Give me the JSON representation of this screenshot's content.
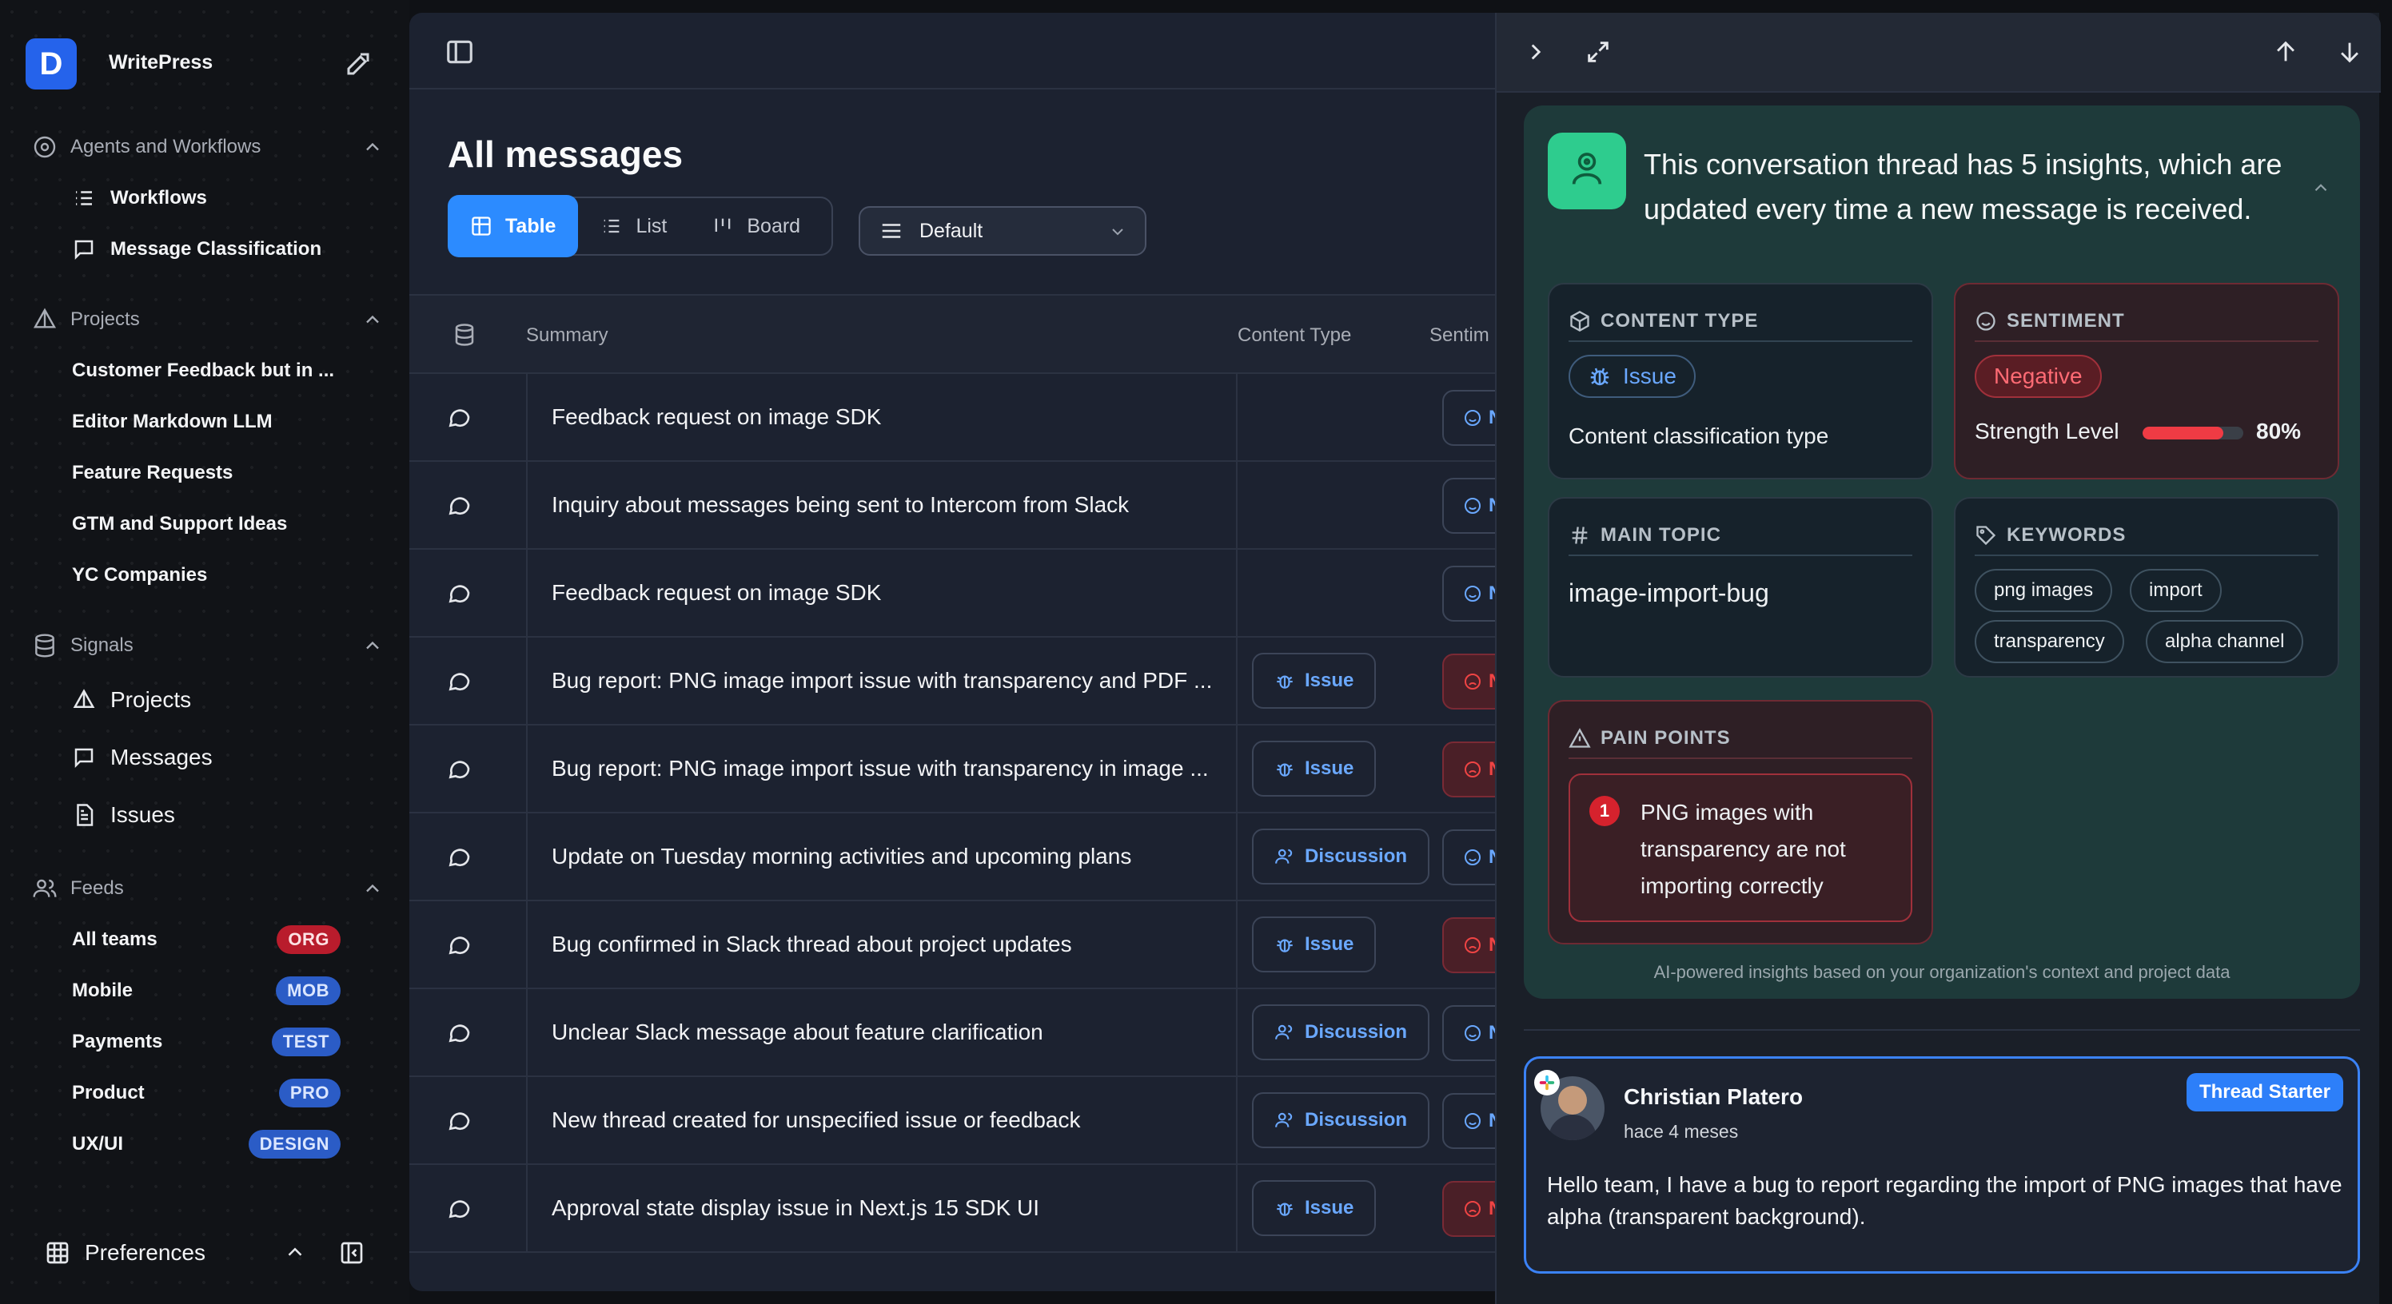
{
  "app": {
    "name": "WritePress",
    "logo_letter": "D"
  },
  "sidebar": {
    "sections": [
      {
        "label": "Agents and Workflows",
        "items": [
          "Workflows",
          "Message Classification"
        ]
      },
      {
        "label": "Projects",
        "items": [
          "Customer Feedback but in ...",
          "Editor Markdown LLM",
          "Feature Requests",
          "GTM and Support Ideas",
          "YC Companies"
        ]
      },
      {
        "label": "Signals",
        "items": [
          "Projects",
          "Messages",
          "Issues"
        ]
      },
      {
        "label": "Feeds",
        "items": [
          {
            "label": "All teams",
            "badge": "ORG"
          },
          {
            "label": "Mobile",
            "badge": "MOB"
          },
          {
            "label": "Payments",
            "badge": "TEST"
          },
          {
            "label": "Product",
            "badge": "PRO"
          },
          {
            "label": "UX/UI",
            "badge": "DESIGN"
          }
        ]
      }
    ],
    "preferences": "Preferences"
  },
  "main": {
    "title": "All messages",
    "views": [
      "Table",
      "List",
      "Board"
    ],
    "sort": "Default",
    "columns": [
      "Summary",
      "Content Type",
      "Sentim"
    ],
    "rows": [
      {
        "summary": "Feedback request on image SDK",
        "type": "",
        "sentiment": "N"
      },
      {
        "summary": "Inquiry about messages being sent to Intercom from Slack",
        "type": "",
        "sentiment": "N"
      },
      {
        "summary": "Feedback request on image SDK",
        "type": "",
        "sentiment": "N"
      },
      {
        "summary": "Bug report: PNG image import issue with transparency and PDF ...",
        "type": "Issue",
        "sentiment": "N"
      },
      {
        "summary": "Bug report: PNG image import issue with transparency in image ...",
        "type": "Issue",
        "sentiment": "N"
      },
      {
        "summary": "Update on Tuesday morning activities and upcoming plans",
        "type": "Discussion",
        "sentiment": "N"
      },
      {
        "summary": "Bug confirmed in Slack thread about project updates",
        "type": "Issue",
        "sentiment": "N"
      },
      {
        "summary": "Unclear Slack message about feature clarification",
        "type": "Discussion",
        "sentiment": "N"
      },
      {
        "summary": "New thread created for unspecified issue or feedback",
        "type": "Discussion",
        "sentiment": "N"
      },
      {
        "summary": "Approval state display issue in Next.js 15 SDK UI",
        "type": "Issue",
        "sentiment": "N"
      }
    ]
  },
  "insights": {
    "title": "This conversation thread has 5 insights, which are updated every time a new message is received.",
    "content_type": {
      "header": "CONTENT TYPE",
      "value": "Issue",
      "caption": "Content classification type"
    },
    "sentiment": {
      "header": "SENTIMENT",
      "value": "Negative",
      "strength_label": "Strength Level",
      "strength": "80%",
      "strength_fraction": 0.8
    },
    "main_topic": {
      "header": "MAIN TOPIC",
      "value": "image-import-bug"
    },
    "keywords": {
      "header": "KEYWORDS",
      "items": [
        "png images",
        "import",
        "transparency",
        "alpha channel"
      ]
    },
    "pain_points": {
      "header": "PAIN POINTS",
      "items": [
        {
          "num": "1",
          "text": "PNG images with transparency are not importing correctly"
        }
      ]
    },
    "footer": "AI-powered insights based on your organization's context and project data"
  },
  "message": {
    "author": "Christian Platero",
    "time": "hace 4 meses",
    "badge": "Thread Starter",
    "body": "Hello team, I have a bug to report regarding the import of PNG images that have alpha (transparent background)."
  },
  "colors": {
    "accent": "#2c8bff",
    "negative": "#ef3b44",
    "insights_bg": "#1e3a3a"
  }
}
